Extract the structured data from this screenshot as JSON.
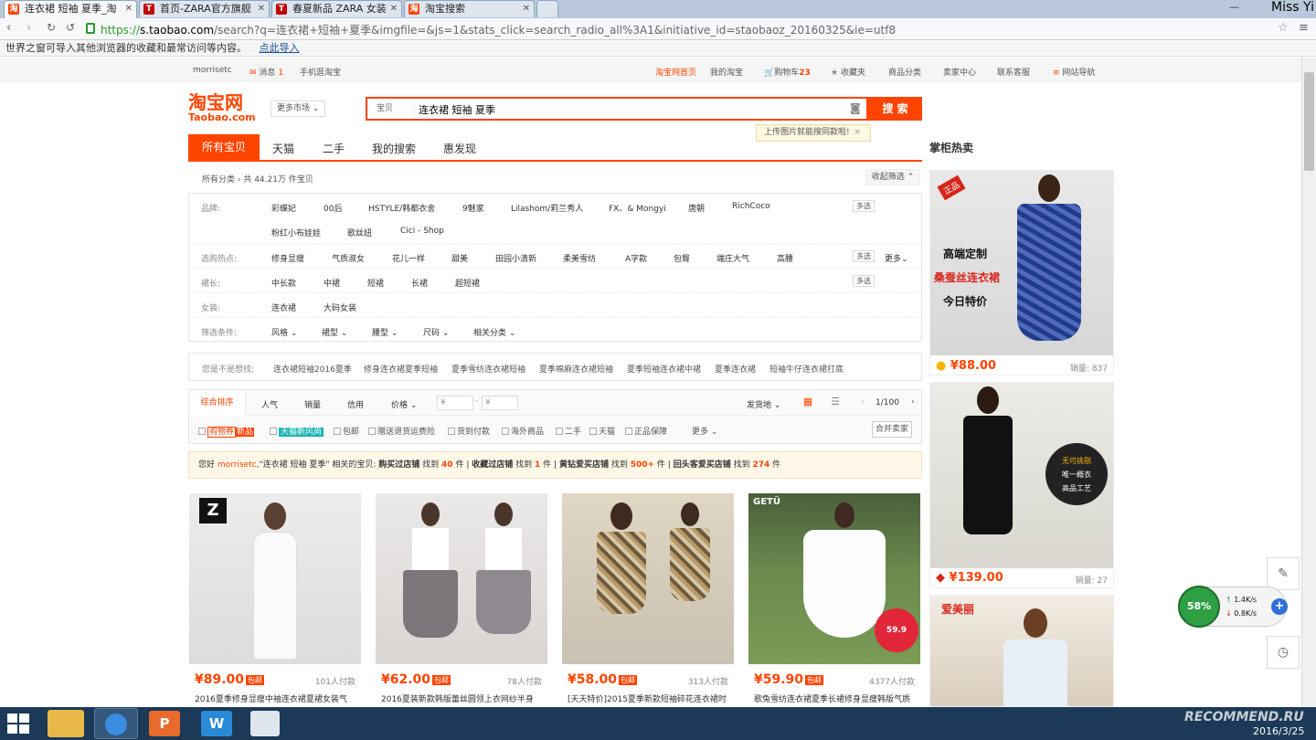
{
  "browser": {
    "tabs": [
      {
        "label": "连衣裙 短袖 夏季_淘",
        "active": true,
        "icon": "taobao-favicon"
      },
      {
        "label": "首页-ZARA官方旗舰",
        "active": false,
        "icon": "tmall-favicon"
      },
      {
        "label": "春夏新品 ZARA 女装",
        "active": false,
        "icon": "tmall-favicon"
      },
      {
        "label": "淘宝搜索",
        "active": false,
        "icon": "taobao-favicon"
      }
    ],
    "user": "Miss Yi",
    "url_secure": "https://",
    "url_host": "s.taobao.com",
    "url_rest": "/search?q=连衣裙+短袖+夏季&imgfile=&js=1&stats_click=search_radio_all%3A1&initiative_id=staobaoz_20160325&ie=utf8",
    "infobar_text": "世界之窗可导入其他浏览器的收藏和最常访问等内容。",
    "infobar_link": "点此导入"
  },
  "topnav": {
    "user": "morrisetc",
    "msg": "消息",
    "msg_count": "1",
    "mobile": "手机逛淘宝",
    "home": "淘宝网首页",
    "mytaobao": "我的淘宝",
    "cart": "购物车",
    "cart_count": "23",
    "fav": "收藏夹",
    "categories": "商品分类",
    "seller": "卖家中心",
    "service": "联系客服",
    "sitenav": "网站导航"
  },
  "header": {
    "logo_cn": "淘宝网",
    "logo_en": "Taobao.com",
    "market": "更多市场",
    "search_scope": "宝贝",
    "search_query": "连衣裙 短袖 夏季",
    "search_button": "搜 索",
    "tooltip": "上传图片就能搜同款啦!"
  },
  "tabs": [
    "所有宝贝",
    "天猫",
    "二手",
    "我的搜索",
    "惠发现"
  ],
  "crumbs": {
    "all": "所有分类",
    "count": "共 44.21万 件宝贝",
    "collapse": "收起筛选"
  },
  "filters": {
    "brand_label": "品牌:",
    "brands_row1": [
      "彩蝶妃",
      "00后",
      "HSTYLE/韩都衣舍",
      "9魅家",
      "Lilashom/莉兰秀人",
      "FX、& Mongyi",
      "唐朝",
      "RichCoco"
    ],
    "brands_row2": [
      "粉红小布娃娃",
      "歌丝妞",
      "Cici - Shop"
    ],
    "hot_label": "选购热点:",
    "hot": [
      "修身显瘦",
      "气质淑女",
      "花儿一样",
      "甜美",
      "田园小清新",
      "柔美雪纺",
      "A字款",
      "包臀",
      "端庄大气",
      "高腰"
    ],
    "length_label": "裙长:",
    "lengths": [
      "中长款",
      "中裙",
      "短裙",
      "长裙",
      "超短裙"
    ],
    "women_label": "女装:",
    "women": [
      "连衣裙",
      "大码女装"
    ],
    "cond_label": "筛选条件:",
    "conds": [
      "风格",
      "裙型",
      "腰型",
      "尺码",
      "相关分类"
    ],
    "multi": "多选",
    "more": "更多"
  },
  "suggest": {
    "label": "您是不是想找:",
    "items": [
      "连衣裙短袖2016夏季",
      "修身连衣裙夏季短袖",
      "夏季雪纺连衣裙短袖",
      "夏季棉麻连衣裙短袖",
      "夏季短袖连衣裙中裙",
      "夏季连衣裙",
      "短袖牛仔连衣裙打底"
    ]
  },
  "sort": {
    "items": [
      "综合排序",
      "人气",
      "销量",
      "信用",
      "价格"
    ],
    "price_from": "¥",
    "price_to": "¥",
    "ship": "发货地",
    "page": "1/100",
    "checks": [
      "购物券",
      "新品",
      "天猫新风尚",
      "包邮",
      "赠送退货运费险",
      "货到付款",
      "海外商品",
      "二手",
      "天猫",
      "正品保障",
      "更多"
    ],
    "merge": "合并卖家"
  },
  "notice": {
    "hello": "您好",
    "user": "morrisetc",
    "text1": ",\"连衣裙 短袖 夏季\" 相关的宝贝:",
    "buy": "购买过店铺",
    "buy_n": "40",
    "fav": "收藏过店铺",
    "fav_n": "1",
    "gold": "黄钻爱买店铺",
    "gold_n": "500+",
    "back": "回头客爱买店铺",
    "back_n": "274",
    "found": "找到",
    "unit": "件"
  },
  "products": [
    {
      "price": "¥89.00",
      "by": "包邮",
      "sales": "101人付款",
      "desc": "2016夏季修身显瘦中袖连衣裙夏裙女装气",
      "color": "#e8e8e8"
    },
    {
      "price": "¥62.00",
      "by": "包邮",
      "sales": "78人付款",
      "desc": "2016夏装新款韩版蕾丝圆领上衣网纱半身",
      "color": "#dcd8d6"
    },
    {
      "price": "¥58.00",
      "by": "包邮",
      "sales": "313人付款",
      "desc": "[天天特价]2015夏季新款短袖碎花连衣裙时",
      "color": "#cfc7b8"
    },
    {
      "price": "¥59.90",
      "by": "包邮",
      "sales": "4377人付款",
      "desc": "歌兔雪纺连衣裙夏季长裙修身显瘦韩版气质",
      "color": "#6f8f4e"
    }
  ],
  "sidebar": {
    "title": "掌柜热卖",
    "items": [
      {
        "price": "¥88.00",
        "sales": "销量: 837",
        "t1": "高端定制",
        "t2": "桑蚕丝连衣裙",
        "t3": "今日特价",
        "tag": "正品"
      },
      {
        "price": "¥139.00",
        "sales": "销量: 27",
        "t1": "无可挑剔",
        "t2": "唯一概衣",
        "t3": "高品工艺"
      },
      {
        "tag": "爱美丽"
      }
    ]
  },
  "widget": {
    "percent": "58%",
    "up": "1.4K/s",
    "down": "0.8K/s"
  },
  "taskbar": {
    "date": "2016/3/25",
    "watermark": "RECOMMEND.RU"
  }
}
